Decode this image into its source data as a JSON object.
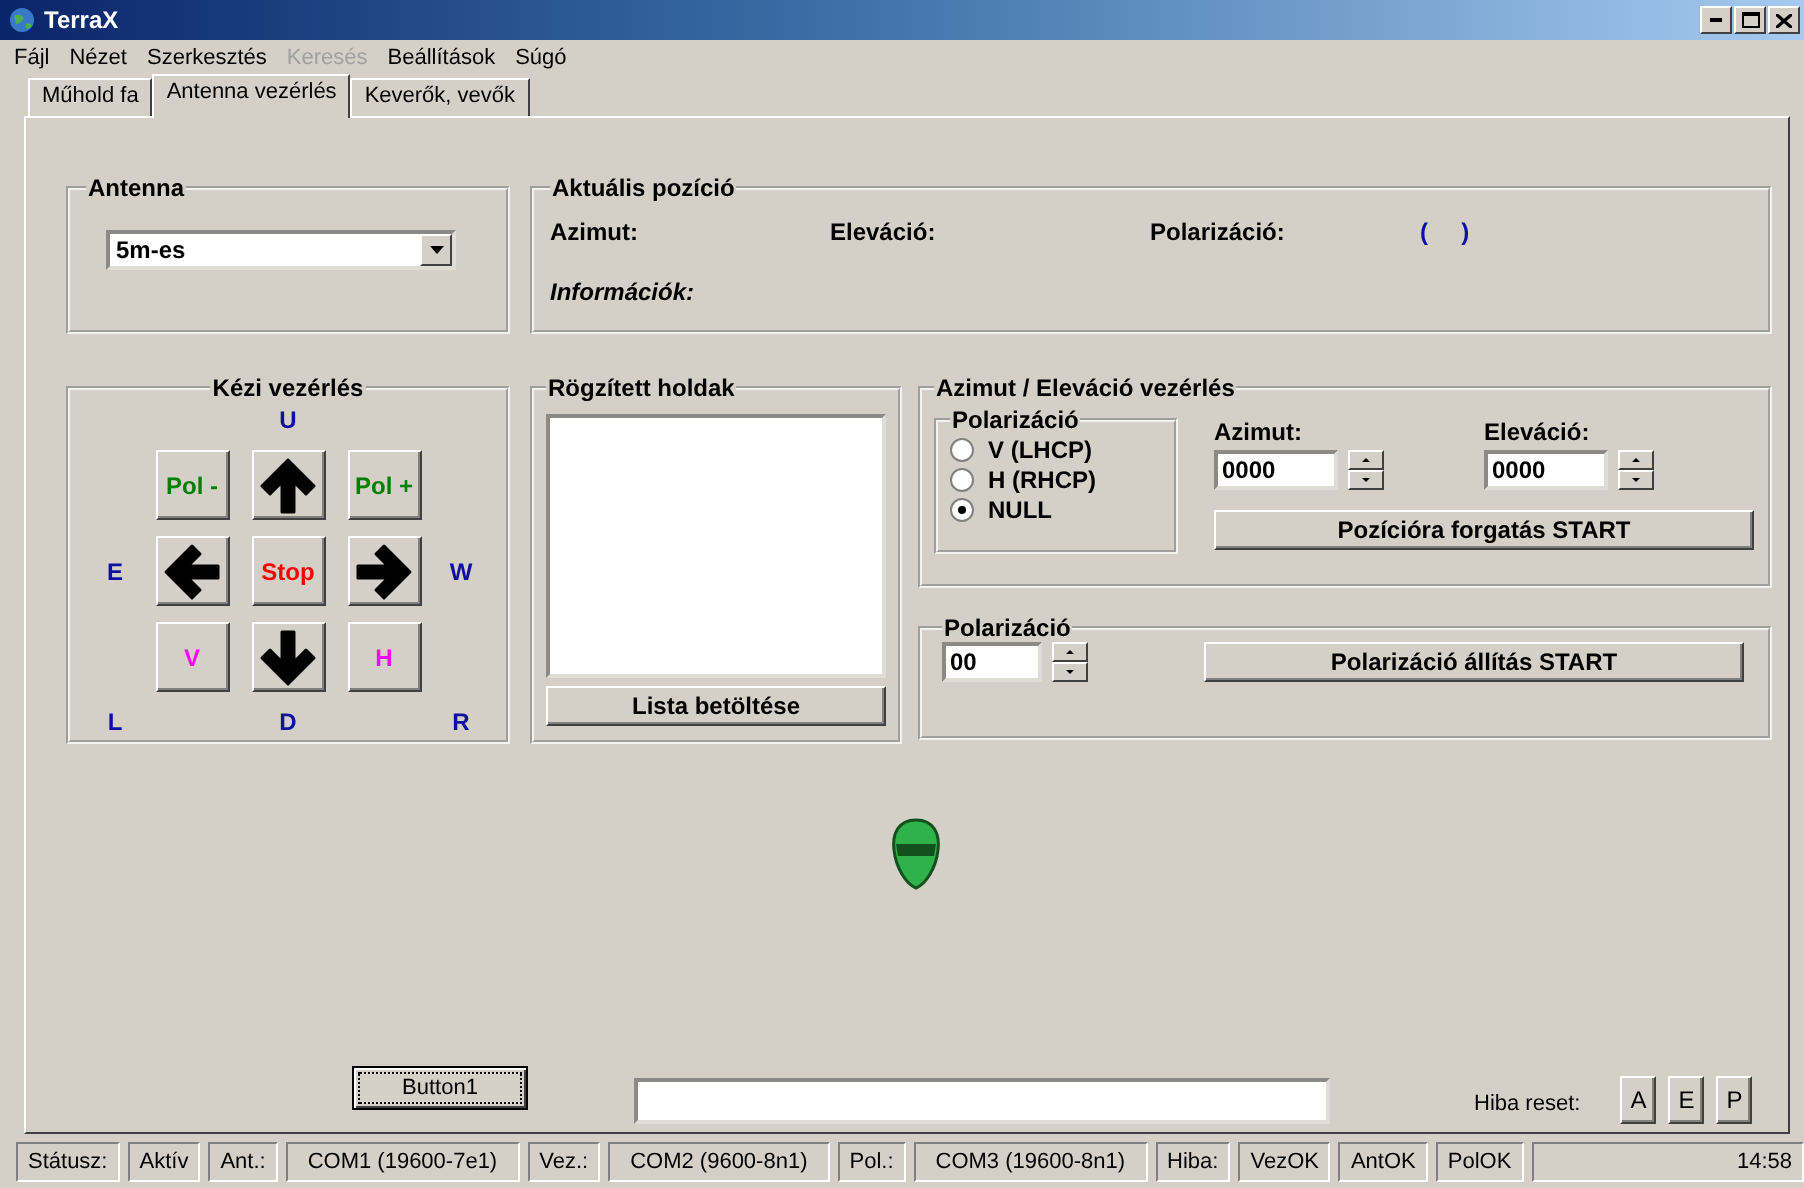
{
  "window": {
    "title": "TerraX"
  },
  "menu": [
    {
      "label": "Fájl",
      "disabled": false
    },
    {
      "label": "Nézet",
      "disabled": false
    },
    {
      "label": "Szerkesztés",
      "disabled": false
    },
    {
      "label": "Keresés",
      "disabled": true
    },
    {
      "label": "Beállítások",
      "disabled": false
    },
    {
      "label": "Súgó",
      "disabled": false
    }
  ],
  "tabs": [
    {
      "label": "Műhold fa",
      "selected": false
    },
    {
      "label": "Antenna vezérlés",
      "selected": true
    },
    {
      "label": "Keverők, vevők",
      "selected": false
    }
  ],
  "antenna": {
    "title": "Antenna",
    "value": "5m-es"
  },
  "position": {
    "title": "Aktuális pozíció",
    "azimuth_label": "Azimut:",
    "elevation_label": "Eleváció:",
    "polarization_label": "Polarizáció:",
    "polarization_value": "(     )",
    "info_label": "Információk:"
  },
  "manual": {
    "title": "Kézi vezérlés",
    "up": "U",
    "left": "E",
    "right": "W",
    "bottom_left": "L",
    "down": "D",
    "bottom_right": "R",
    "buttons": [
      {
        "kind": "text",
        "label": "Pol -",
        "color": "#008000"
      },
      {
        "kind": "up"
      },
      {
        "kind": "text",
        "label": "Pol +",
        "color": "#008000"
      },
      {
        "kind": "left"
      },
      {
        "kind": "text",
        "label": "Stop",
        "color": "#ff0000"
      },
      {
        "kind": "right"
      },
      {
        "kind": "text",
        "label": "V",
        "color": "#ff00ff"
      },
      {
        "kind": "down"
      },
      {
        "kind": "text",
        "label": "H",
        "color": "#ff00ff"
      }
    ]
  },
  "saved": {
    "title": "Rögzített holdak",
    "button": "Lista betöltése"
  },
  "azel": {
    "title": "Azimut / Eleváció vezérlés",
    "polarization": {
      "title": "Polarizáció",
      "options": [
        {
          "label": "V (LHCP)",
          "selected": false
        },
        {
          "label": "H (RHCP)",
          "selected": false
        },
        {
          "label": "NULL",
          "selected": true
        }
      ]
    },
    "azimuth": {
      "label": "Azimut:",
      "value": "0000"
    },
    "elevation": {
      "label": "Eleváció:",
      "value": "0000"
    },
    "button": "Pozícióra forgatás START"
  },
  "polarization": {
    "title": "Polarizáció",
    "value": "00",
    "button": "Polarizáció állítás START"
  },
  "footer": {
    "button": "Button1",
    "reset_label": "Hiba reset:",
    "reset_buttons": [
      "A",
      "E",
      "P"
    ]
  },
  "status_bar": [
    "Státusz:",
    "Aktív",
    "Ant.:",
    "COM1 (19600-7e1)",
    "Vez.:",
    "COM2 (9600-8n1)",
    "Pol.:",
    "COM3 (19600-8n1)",
    "Hiba:",
    "VezOK",
    "AntOK",
    "PolOK",
    "14:58"
  ]
}
